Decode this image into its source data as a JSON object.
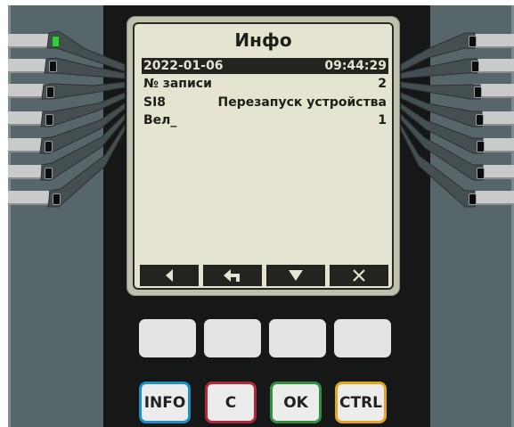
{
  "screen": {
    "title": "Инфо",
    "rows": [
      {
        "left": "2022-01-06",
        "right": "09:44:29",
        "selected": true
      },
      {
        "left": "№ записи",
        "right": "2",
        "selected": false
      },
      {
        "left": "SI8",
        "right": "Перезапуск устройства",
        "selected": false
      },
      {
        "left": "Вел_",
        "right": "1",
        "selected": false
      }
    ],
    "softkeys": [
      "left-arrow-icon",
      "enter-return-icon",
      "down-arrow-icon",
      "close-x-icon"
    ]
  },
  "keys": {
    "info": "INFO",
    "c": "C",
    "ok": "OK",
    "ctrl": "CTRL"
  },
  "key_colors": {
    "info": "#1d8fc9",
    "c": "#b0283a",
    "ok": "#2f9140",
    "ctrl": "#e1a520"
  },
  "leds": {
    "left": [
      "on",
      "off",
      "off",
      "off",
      "off",
      "off",
      "off"
    ],
    "right": [
      "off",
      "off",
      "off",
      "off",
      "off",
      "off",
      "off"
    ],
    "on_color": "#37c93c"
  },
  "lcd_colors": {
    "background": "#e5e4d1",
    "text": "#1e1e1a"
  }
}
